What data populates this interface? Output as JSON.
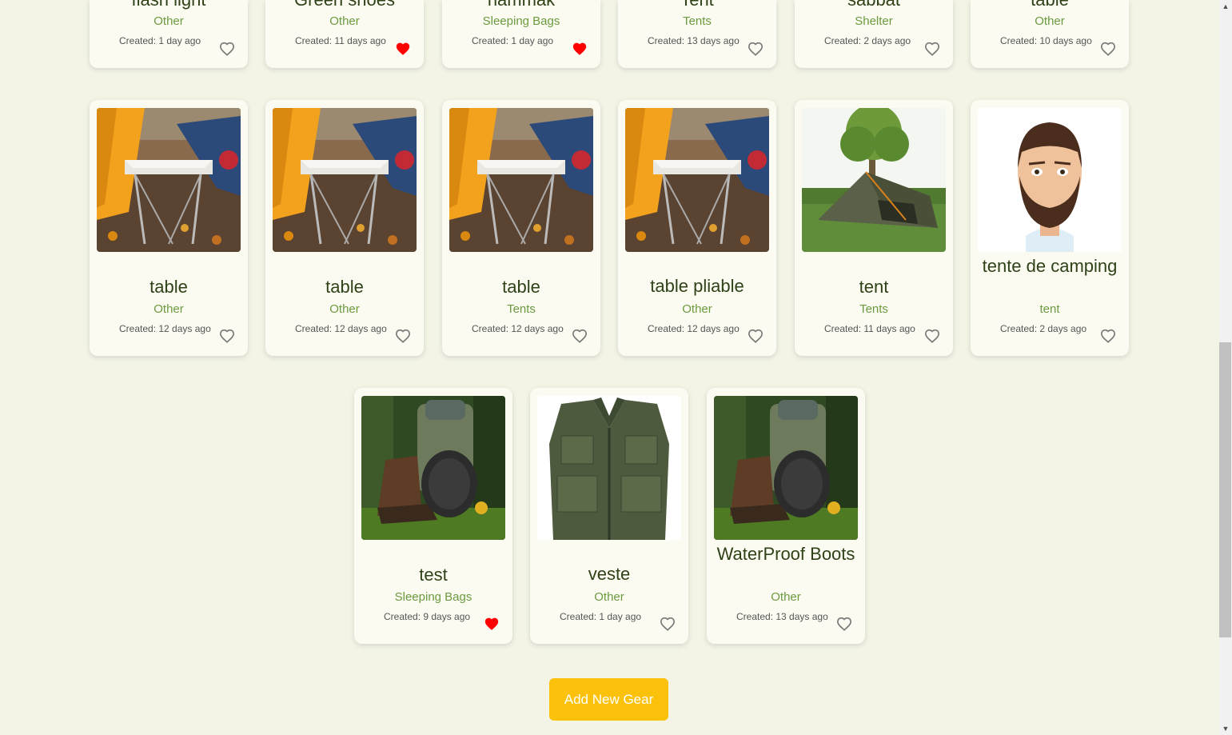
{
  "top_row": [
    {
      "name": "flash light",
      "category": "Other",
      "created": "Created: 1 day ago",
      "favorited": false
    },
    {
      "name": "Green shoes",
      "category": "Other",
      "created": "Created: 11 days ago",
      "favorited": true
    },
    {
      "name": "hammak",
      "category": "Sleeping Bags",
      "created": "Created: 1 day ago",
      "favorited": true
    },
    {
      "name": "Tent",
      "category": "Tents",
      "created": "Created: 13 days ago",
      "favorited": false
    },
    {
      "name": "sabbat",
      "category": "Shelter",
      "created": "Created: 2 days ago",
      "favorited": false
    },
    {
      "name": "table",
      "category": "Other",
      "created": "Created: 10 days ago",
      "favorited": false
    }
  ],
  "middle_row": [
    {
      "name": "table",
      "category": "Other",
      "created": "Created: 12 days ago",
      "favorited": false,
      "image": "camp-table-image"
    },
    {
      "name": "table",
      "category": "Other",
      "created": "Created: 12 days ago",
      "favorited": false,
      "image": "camp-table-image"
    },
    {
      "name": "table",
      "category": "Tents",
      "created": "Created: 12 days ago",
      "favorited": false,
      "image": "camp-table-image"
    },
    {
      "name": "table pliable",
      "category": "Other",
      "created": "Created: 12 days ago",
      "favorited": false,
      "image": "camp-table-image"
    },
    {
      "name": "tent",
      "category": "Tents",
      "created": "Created: 11 days ago",
      "favorited": false,
      "image": "tent-image"
    },
    {
      "name": "tente de camping",
      "category": "tent",
      "created": "Created: 2 days ago",
      "favorited": false,
      "image": "avatar-image"
    }
  ],
  "bottom_row": [
    {
      "name": "test",
      "category": "Sleeping Bags",
      "created": "Created: 9 days ago",
      "favorited": true,
      "image": "boots-image"
    },
    {
      "name": "veste",
      "category": "Other",
      "created": "Created: 1 day ago",
      "favorited": false,
      "image": "vest-image"
    },
    {
      "name": "WaterProof Boots",
      "category": "Other",
      "created": "Created: 13 days ago",
      "favorited": false,
      "image": "boots-image"
    }
  ],
  "add_button_label": "Add New Gear",
  "colors": {
    "background": "#f3f4e6",
    "card": "#fbfbf2",
    "title": "#2f4117",
    "category": "#6b9a3f",
    "accent_button": "#fcc10a",
    "heart_active": "#ff0000",
    "heart_inactive": "#777777"
  }
}
